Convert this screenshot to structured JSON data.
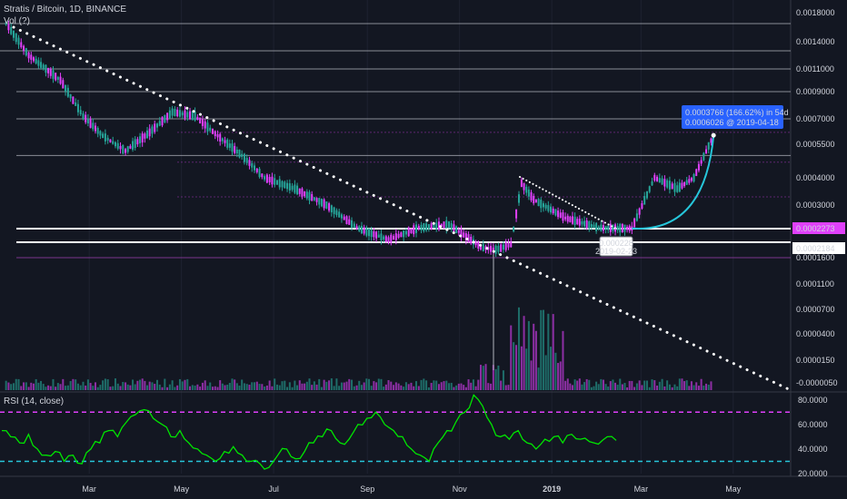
{
  "header": {
    "symbol_line": "Stratis / Bitcoin, 1D, BINANCE",
    "vol_label": "Vol (?)"
  },
  "rsi_header": "RSI (14, close)",
  "badges": {
    "last_price": "0.0002273",
    "level_price": "0.0002184",
    "pivot_price": "0.000228",
    "pivot_date": "2019-02-23",
    "measure_main": "0.0003766 (166.62%) in 54d",
    "measure_sub": "0.0006026  @ 2019-04-18"
  },
  "colors": {
    "background": "#131722",
    "up": "#26a69a",
    "down": "#e040fb",
    "rsi_line": "#00e600",
    "rsi_upper": "#e040fb",
    "rsi_lower": "#26c6da",
    "trend": "#ffffff",
    "arc": "#26c6da",
    "badge_blue": "#2962ff",
    "badge_pink": "#e040fb"
  },
  "chart_data": [
    {
      "type": "candlestick",
      "title": "Stratis / Bitcoin, 1D, BINANCE",
      "x_ticks": [
        "Mar",
        "May",
        "Jul",
        "Sep",
        "Nov",
        "2019",
        "Mar",
        "May"
      ],
      "y_ticks": [
        "0.0018000",
        "0.0014000",
        "0.0011000",
        "0.0009000",
        "0.0007000",
        "0.0005500",
        "0.0004000",
        "0.0003000",
        "0.0002273",
        "0.0002184",
        "0.0001600",
        "0.0001100",
        "0.0000700",
        "0.0000400",
        "0.0000150",
        "-0.0000050"
      ],
      "y_scale": "log",
      "price_path": [
        [
          "2018-01-05",
          0.00165
        ],
        [
          "2018-01-20",
          0.00125
        ],
        [
          "2018-02-10",
          0.001
        ],
        [
          "2018-02-25",
          0.00072
        ],
        [
          "2018-03-10",
          0.0006
        ],
        [
          "2018-03-25",
          0.00052
        ],
        [
          "2018-04-10",
          0.00062
        ],
        [
          "2018-04-25",
          0.00075
        ],
        [
          "2018-05-10",
          0.00072
        ],
        [
          "2018-05-25",
          0.0006
        ],
        [
          "2018-06-10",
          0.0005
        ],
        [
          "2018-06-25",
          0.0004
        ],
        [
          "2018-07-15",
          0.00036
        ],
        [
          "2018-08-05",
          0.0003
        ],
        [
          "2018-08-25",
          0.00023
        ],
        [
          "2018-09-15",
          0.00022
        ],
        [
          "2018-10-05",
          0.00023
        ],
        [
          "2018-10-25",
          0.00024
        ],
        [
          "2018-11-15",
          0.0002
        ],
        [
          "2018-11-25",
          0.00019
        ],
        [
          "2018-12-05",
          0.00021
        ],
        [
          "2018-12-12",
          0.00038
        ],
        [
          "2018-12-20",
          0.00032
        ],
        [
          "2019-01-10",
          0.00026
        ],
        [
          "2019-02-01",
          0.00023
        ],
        [
          "2019-02-23",
          0.000228
        ],
        [
          "2019-03-10",
          0.0004
        ],
        [
          "2019-03-25",
          0.00036
        ],
        [
          "2019-04-05",
          0.0004
        ],
        [
          "2019-04-18",
          0.0006026
        ]
      ],
      "horizontal_levels": [
        0.00165,
        0.0013,
        0.0011,
        0.0009,
        0.0007,
        0.0005,
        0.0002273,
        0.0002184,
        0.00016
      ],
      "trendline": {
        "from": [
          "2018-01-10",
          0.0016
        ],
        "to": [
          "2019-05-25",
          5e-06
        ]
      },
      "measure": {
        "from": [
          "2019-02-23",
          0.000228
        ],
        "to": [
          "2019-04-18",
          0.0006026
        ],
        "change": "0.0003766 (166.62%) in 54d"
      }
    },
    {
      "type": "bar",
      "title": "Vol",
      "note": "volume histogram along bottom of price pane"
    },
    {
      "type": "line",
      "title": "RSI (14, close)",
      "y_ticks": [
        "80.0000",
        "60.0000",
        "40.0000",
        "20.0000"
      ],
      "ylim": [
        20,
        85
      ],
      "bands": [
        70,
        30
      ],
      "values": [
        55,
        50,
        45,
        52,
        40,
        35,
        38,
        30,
        35,
        28,
        40,
        45,
        55,
        50,
        62,
        68,
        72,
        65,
        60,
        50,
        55,
        45,
        40,
        35,
        30,
        38,
        42,
        35,
        30,
        28,
        25,
        35,
        40,
        32,
        38,
        45,
        50,
        55,
        45,
        48,
        60,
        65,
        70,
        60,
        55,
        50,
        40,
        35,
        30,
        45,
        55,
        62,
        70,
        84,
        75,
        60,
        50,
        48,
        55,
        45,
        40,
        48,
        50,
        45,
        52,
        48,
        46,
        44,
        50,
        47
      ]
    }
  ]
}
